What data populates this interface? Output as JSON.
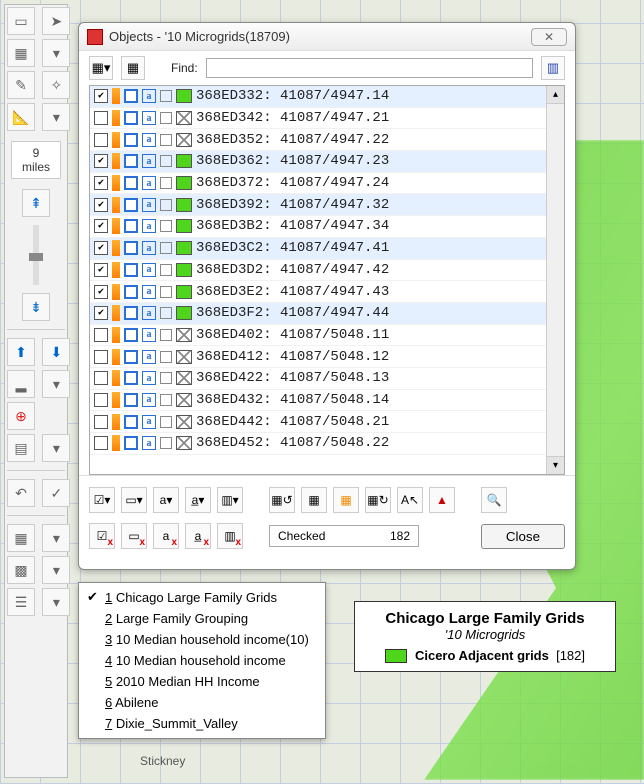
{
  "dialog": {
    "title": "Objects - '10 Microgrids(18709)",
    "find_label": "Find:",
    "find_value": "",
    "checked_label": "Checked",
    "checked_count": "182",
    "close_label": "Close"
  },
  "scale": {
    "value": "9",
    "unit": "miles"
  },
  "rows": [
    {
      "checked": true,
      "green": true,
      "label": "368ED332: 41087/4947.14",
      "sel": true
    },
    {
      "checked": false,
      "green": false,
      "label": "368ED342: 41087/4947.21",
      "sel": false
    },
    {
      "checked": false,
      "green": false,
      "label": "368ED352: 41087/4947.22",
      "sel": false
    },
    {
      "checked": true,
      "green": true,
      "label": "368ED362: 41087/4947.23",
      "sel": true
    },
    {
      "checked": true,
      "green": true,
      "label": "368ED372: 41087/4947.24",
      "sel": false
    },
    {
      "checked": true,
      "green": true,
      "label": "368ED392: 41087/4947.32",
      "sel": true
    },
    {
      "checked": true,
      "green": true,
      "label": "368ED3B2: 41087/4947.34",
      "sel": false
    },
    {
      "checked": true,
      "green": true,
      "label": "368ED3C2: 41087/4947.41",
      "sel": true
    },
    {
      "checked": true,
      "green": true,
      "label": "368ED3D2: 41087/4947.42",
      "sel": false
    },
    {
      "checked": true,
      "green": true,
      "label": "368ED3E2: 41087/4947.43",
      "sel": false
    },
    {
      "checked": true,
      "green": true,
      "label": "368ED3F2: 41087/4947.44",
      "sel": true
    },
    {
      "checked": false,
      "green": false,
      "label": "368ED402: 41087/5048.11",
      "sel": false
    },
    {
      "checked": false,
      "green": false,
      "label": "368ED412: 41087/5048.12",
      "sel": false
    },
    {
      "checked": false,
      "green": false,
      "label": "368ED422: 41087/5048.13",
      "sel": false
    },
    {
      "checked": false,
      "green": false,
      "label": "368ED432: 41087/5048.14",
      "sel": false
    },
    {
      "checked": false,
      "green": false,
      "label": "368ED442: 41087/5048.21",
      "sel": false
    },
    {
      "checked": false,
      "green": false,
      "label": "368ED452: 41087/5048.22",
      "sel": false
    }
  ],
  "menu": {
    "items": [
      {
        "hot": "1",
        "label": "Chicago Large Family Grids",
        "checked": true
      },
      {
        "hot": "2",
        "label": "Large Family Grouping",
        "checked": false
      },
      {
        "hot": "3",
        "label": "10 Median household income(10)",
        "checked": false
      },
      {
        "hot": "4",
        "label": "10 Median household income",
        "checked": false
      },
      {
        "hot": "5",
        "label": "2010 Median HH Income",
        "checked": false
      },
      {
        "hot": "6",
        "label": "Abilene",
        "checked": false
      },
      {
        "hot": "7",
        "label": "Dixie_Summit_Valley",
        "checked": false
      }
    ]
  },
  "legend": {
    "title": "Chicago Large Family Grids",
    "subtitle": "'10 Microgrids",
    "entry_label": "Cicero Adjacent grids",
    "entry_count": "[182]"
  },
  "map": {
    "label_stickney": "Stickney"
  }
}
